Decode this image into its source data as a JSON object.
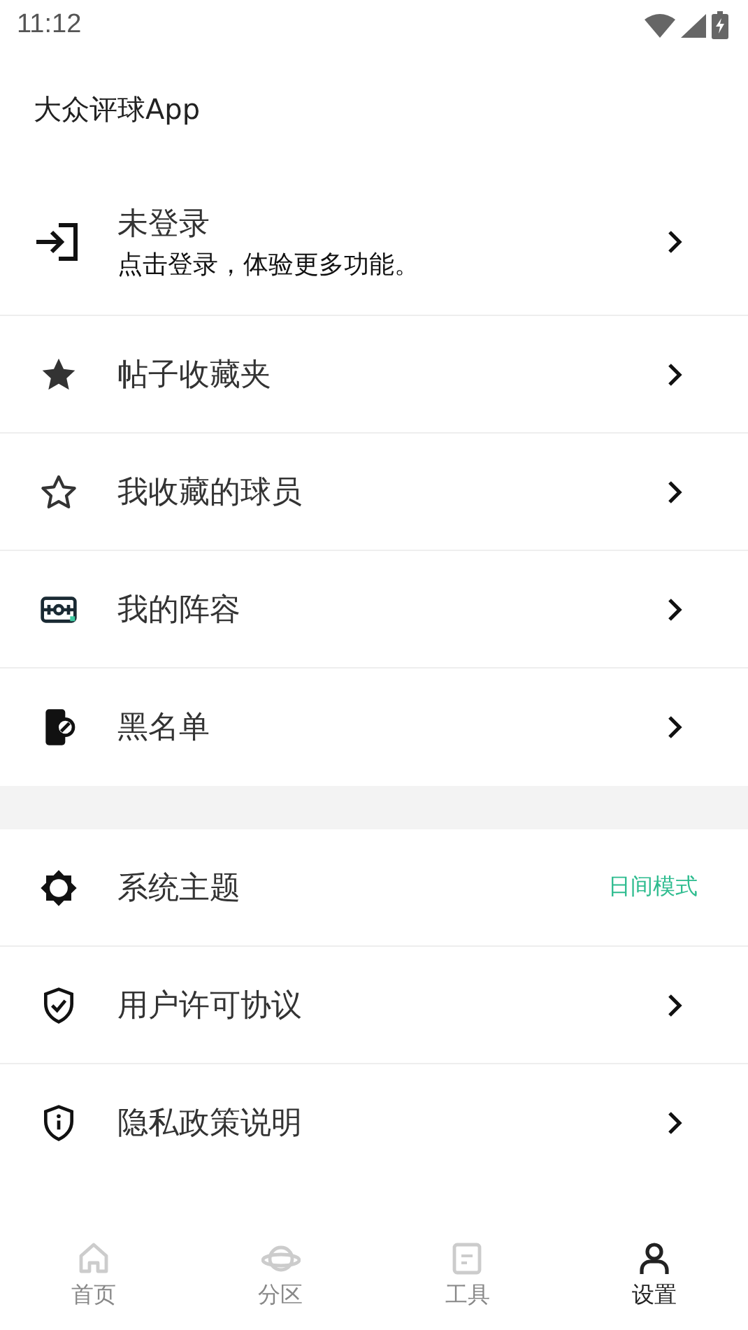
{
  "status_bar": {
    "time": "11:12"
  },
  "header": {
    "title": "大众评球App"
  },
  "login": {
    "title": "未登录",
    "subtitle": "点击登录，体验更多功能。"
  },
  "sections": [
    {
      "items": [
        {
          "label": "帖子收藏夹",
          "kind": "arrow"
        },
        {
          "label": "我收藏的球员",
          "kind": "arrow"
        },
        {
          "label": "我的阵容",
          "kind": "arrow"
        },
        {
          "label": "黑名单",
          "kind": "arrow"
        }
      ]
    },
    {
      "items": [
        {
          "label": "系统主题",
          "kind": "value",
          "value": "日间模式"
        },
        {
          "label": "用户许可协议",
          "kind": "arrow"
        },
        {
          "label": "隐私政策说明",
          "kind": "arrow"
        }
      ]
    }
  ],
  "tabs": [
    {
      "label": "首页",
      "selected": false
    },
    {
      "label": "分区",
      "selected": false
    },
    {
      "label": "工具",
      "selected": false
    },
    {
      "label": "设置",
      "selected": true
    }
  ]
}
